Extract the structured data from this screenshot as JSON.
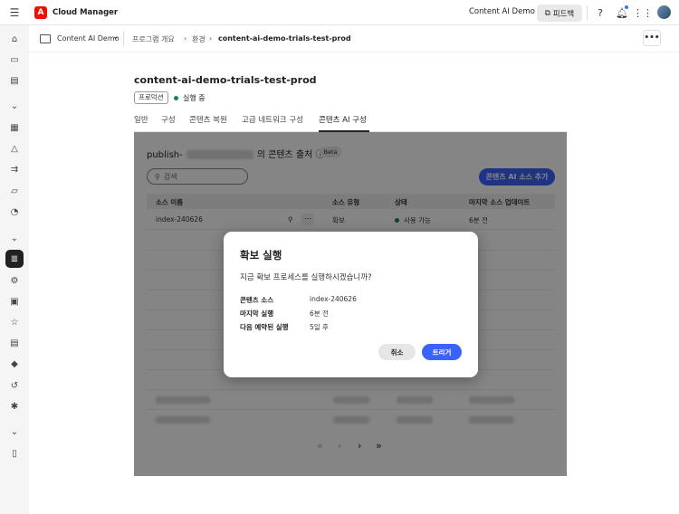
{
  "topbar": {
    "app_title": "Cloud Manager",
    "org_name": "Content AI Demo",
    "feedback_label": "피드백"
  },
  "subbar": {
    "env_selector": "Content AI Demo",
    "breadcrumbs": [
      "프로그램 개요",
      "환경",
      "content-ai-demo-trials-test-prod"
    ]
  },
  "page": {
    "title": "content-ai-demo-trials-test-prod",
    "env_badge": "프로덕션",
    "status": "실행 중",
    "tabs": [
      "일반",
      "구성",
      "콘텐츠 복원",
      "고급 네트워크 구성",
      "콘텐츠 AI 구성"
    ],
    "active_tab": "콘텐츠 AI 구성"
  },
  "card": {
    "title_prefix": "publish-",
    "title_suffix": "의 콘텐츠 출처",
    "beta": "Beta",
    "search_placeholder": "검색",
    "add_button": "콘텐츠 AI 소스 추가",
    "columns": [
      "소스 이름",
      "소스 유형",
      "상태",
      "마지막 소스 업데이트"
    ],
    "first_row": {
      "name": "index-240626",
      "type": "확보",
      "status": "사용 가능",
      "updated": "6분 전"
    }
  },
  "dialog": {
    "title": "확보 실행",
    "body": "지금 확보 프로세스를 실행하시겠습니까?",
    "rows": [
      {
        "key": "콘텐츠 소스",
        "value": "index-240626"
      },
      {
        "key": "마지막 실행",
        "value": "6분 전"
      },
      {
        "key": "다음 예약된 실행",
        "value": "5일 후"
      }
    ],
    "cancel": "취소",
    "trigger": "트리거"
  },
  "colors": {
    "accent": "#3b63fb",
    "adobe_red": "#eb1000",
    "status_green": "#12805c"
  }
}
